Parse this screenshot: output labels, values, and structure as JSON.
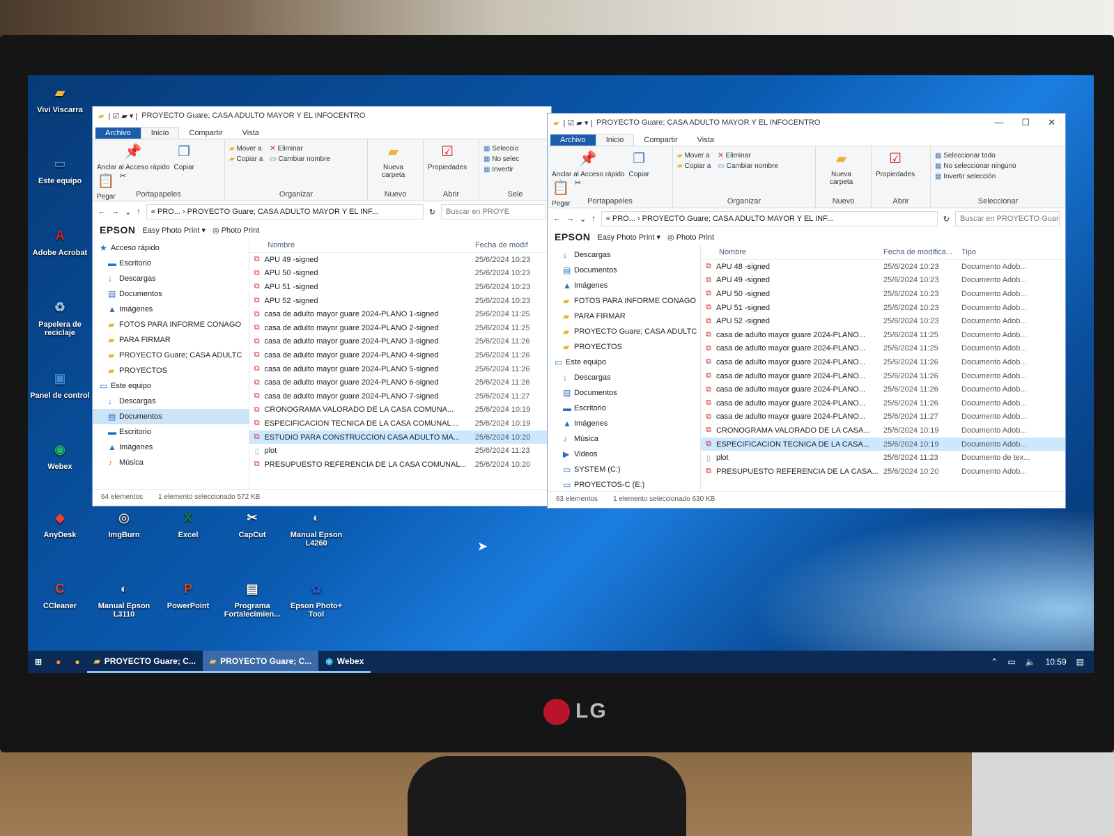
{
  "monitor": {
    "brand": "LG"
  },
  "desktop": {
    "icons": [
      {
        "label": "Vivi Viscarra",
        "icon": "folder-icon",
        "color": "#f2b632"
      },
      {
        "label": "Este equipo",
        "icon": "computer-icon",
        "color": "#3a8ad8"
      },
      {
        "label": "Adobe Acrobat",
        "icon": "acrobat-icon",
        "color": "#d3222a"
      },
      {
        "label": "Papelera de reciclaje",
        "icon": "recycle-bin-icon",
        "color": "#9cc8ee"
      },
      {
        "label": "Panel de control",
        "icon": "control-panel-icon",
        "color": "#3a8ad8"
      },
      {
        "label": "Webex",
        "icon": "webex-icon",
        "color": "#1eb46e"
      },
      {
        "label": "AnyDesk",
        "icon": "anydesk-icon",
        "color": "#e8412c"
      },
      {
        "label": "ImgBurn",
        "icon": "imgburn-icon",
        "color": "#cfcfcf"
      },
      {
        "label": "Excel",
        "icon": "excel-icon",
        "color": "#1e7a45"
      },
      {
        "label": "CapCut",
        "icon": "capcut-icon",
        "color": "#ffffff"
      },
      {
        "label": "Manual Epson L4260",
        "icon": "manual-icon",
        "color": "#cfd8e4"
      },
      {
        "label": "CCleaner",
        "icon": "ccleaner-icon",
        "color": "#e8412c"
      },
      {
        "label": "Manual Epson L3110",
        "icon": "manual-icon",
        "color": "#cfd8e4"
      },
      {
        "label": "PowerPoint",
        "icon": "powerpoint-icon",
        "color": "#d24726"
      },
      {
        "label": "Programa Fortalecimien...",
        "icon": "pdf-file-icon",
        "color": "#ffffff"
      },
      {
        "label": "Epson Photo+ Tool",
        "icon": "epson-photo-icon",
        "color": "#2a5fc8"
      }
    ]
  },
  "explorer_left": {
    "title": "PROYECTO Guare; CASA ADULTO MAYOR Y EL INFOCENTRO",
    "tabs": [
      "Archivo",
      "Inicio",
      "Compartir",
      "Vista"
    ],
    "ribbon": {
      "pin": "Anclar al Acceso rápido",
      "copy": "Copiar",
      "paste": "Pegar",
      "move": "Mover a",
      "copyto": "Copiar a",
      "delete": "Eliminar",
      "rename": "Cambiar nombre",
      "newfolder": "Nueva carpeta",
      "props": "Propiedades",
      "selall": "Seleccio",
      "selnone": "No selec",
      "invert": "Invertir",
      "g_clip": "Portapapeles",
      "g_org": "Organizar",
      "g_new": "Nuevo",
      "g_open": "Abrir",
      "g_sel": "Sele"
    },
    "address": {
      "path": "« PRO... › PROYECTO Guare; CASA ADULTO MAYOR Y EL INF...",
      "search": "Buscar en PROYE"
    },
    "epson": {
      "brand": "EPSON",
      "app": "Easy Photo Print",
      "photo": "Photo Print"
    },
    "nav": [
      {
        "label": "Acceso rápido",
        "icon": "star-icon",
        "sub": false,
        "sel": false
      },
      {
        "label": "Escritorio",
        "icon": "desktop-icon",
        "sub": true,
        "sel": false
      },
      {
        "label": "Descargas",
        "icon": "download-icon",
        "sub": true,
        "sel": false
      },
      {
        "label": "Documentos",
        "icon": "document-icon",
        "sub": true,
        "sel": false
      },
      {
        "label": "Imágenes",
        "icon": "image-icon",
        "sub": true,
        "sel": false
      },
      {
        "label": "FOTOS PARA INFORME CONAGO",
        "icon": "folder-icon",
        "sub": true,
        "sel": false
      },
      {
        "label": "PARA FIRMAR",
        "icon": "folder-icon",
        "sub": true,
        "sel": false
      },
      {
        "label": "PROYECTO Guare; CASA ADULTC",
        "icon": "folder-icon",
        "sub": true,
        "sel": false
      },
      {
        "label": "PROYECTOS",
        "icon": "folder-icon",
        "sub": true,
        "sel": false
      },
      {
        "label": "Este equipo",
        "icon": "computer-icon",
        "sub": false,
        "sel": false
      },
      {
        "label": "Descargas",
        "icon": "download-icon",
        "sub": true,
        "sel": false
      },
      {
        "label": "Documentos",
        "icon": "document-icon",
        "sub": true,
        "sel": true
      },
      {
        "label": "Escritorio",
        "icon": "desktop-icon",
        "sub": true,
        "sel": false
      },
      {
        "label": "Imágenes",
        "icon": "image-icon",
        "sub": true,
        "sel": false
      },
      {
        "label": "Música",
        "icon": "music-icon",
        "sub": true,
        "sel": false
      }
    ],
    "columns": {
      "name": "Nombre",
      "date": "Fecha de modif"
    },
    "files": [
      {
        "name": "APU 49 -signed",
        "date": "25/6/2024 10:23",
        "pdf": true,
        "sel": false
      },
      {
        "name": "APU 50 -signed",
        "date": "25/6/2024 10:23",
        "pdf": true,
        "sel": false
      },
      {
        "name": "APU 51 -signed",
        "date": "25/6/2024 10:23",
        "pdf": true,
        "sel": false
      },
      {
        "name": "APU 52 -signed",
        "date": "25/6/2024 10:23",
        "pdf": true,
        "sel": false
      },
      {
        "name": "casa de adulto mayor guare 2024-PLANO 1-signed",
        "date": "25/6/2024 11:25",
        "pdf": true,
        "sel": false
      },
      {
        "name": "casa de adulto mayor guare 2024-PLANO 2-signed",
        "date": "25/6/2024 11:25",
        "pdf": true,
        "sel": false
      },
      {
        "name": "casa de adulto mayor guare 2024-PLANO 3-signed",
        "date": "25/6/2024 11:26",
        "pdf": true,
        "sel": false
      },
      {
        "name": "casa de adulto mayor guare 2024-PLANO 4-signed",
        "date": "25/6/2024 11:26",
        "pdf": true,
        "sel": false
      },
      {
        "name": "casa de adulto mayor guare 2024-PLANO 5-signed",
        "date": "25/6/2024 11:26",
        "pdf": true,
        "sel": false
      },
      {
        "name": "casa de adulto mayor guare 2024-PLANO 6-signed",
        "date": "25/6/2024 11:26",
        "pdf": true,
        "sel": false
      },
      {
        "name": "casa de adulto mayor guare 2024-PLANO 7-signed",
        "date": "25/6/2024 11:27",
        "pdf": true,
        "sel": false
      },
      {
        "name": "CRONOGRAMA VALORADO DE LA CASA COMUNA...",
        "date": "25/6/2024 10:19",
        "pdf": true,
        "sel": false
      },
      {
        "name": "ESPECIFICACION TECNICA DE LA CASA COMUNAL ...",
        "date": "25/6/2024 10:19",
        "pdf": true,
        "sel": false
      },
      {
        "name": "ESTUDIO PARA CONSTRUCCION CASA ADULTO MA...",
        "date": "25/6/2024 10:20",
        "pdf": true,
        "sel": true
      },
      {
        "name": "plot",
        "date": "25/6/2024 11:23",
        "pdf": false,
        "sel": false
      },
      {
        "name": "PRESUPUESTO REFERENCIA DE LA CASA COMUNAL...",
        "date": "25/6/2024 10:20",
        "pdf": true,
        "sel": false
      }
    ],
    "status": {
      "count": "64 elementos",
      "selected": "1 elemento seleccionado 572 KB"
    }
  },
  "explorer_right": {
    "title": "PROYECTO Guare; CASA ADULTO MAYOR Y EL INFOCENTRO",
    "tabs": [
      "Archivo",
      "Inicio",
      "Compartir",
      "Vista"
    ],
    "ribbon": {
      "pin": "Anclar al Acceso rápido",
      "copy": "Copiar",
      "paste": "Pegar",
      "move": "Mover a",
      "copyto": "Copiar a",
      "delete": "Eliminar",
      "rename": "Cambiar nombre",
      "newfolder": "Nueva carpeta",
      "props": "Propiedades",
      "selall": "Seleccionar todo",
      "selnone": "No seleccionar ninguno",
      "invert": "Invertir selección",
      "g_clip": "Portapapeles",
      "g_org": "Organizar",
      "g_new": "Nuevo",
      "g_open": "Abrir",
      "g_sel": "Seleccionar"
    },
    "address": {
      "path": "« PRO... › PROYECTO Guare; CASA ADULTO MAYOR Y EL INF...",
      "search": "Buscar en PROYECTO Guare; ..."
    },
    "epson": {
      "brand": "EPSON",
      "app": "Easy Photo Print",
      "photo": "Photo Print"
    },
    "nav": [
      {
        "label": "Descargas",
        "icon": "download-icon",
        "sub": true,
        "sel": false
      },
      {
        "label": "Documentos",
        "icon": "document-icon",
        "sub": true,
        "sel": false
      },
      {
        "label": "Imágenes",
        "icon": "image-icon",
        "sub": true,
        "sel": false
      },
      {
        "label": "FOTOS PARA INFORME CONAGO",
        "icon": "folder-icon",
        "sub": true,
        "sel": false
      },
      {
        "label": "PARA FIRMAR",
        "icon": "folder-icon",
        "sub": true,
        "sel": false
      },
      {
        "label": "PROYECTO Guare; CASA ADULTC",
        "icon": "folder-icon",
        "sub": true,
        "sel": false
      },
      {
        "label": "PROYECTOS",
        "icon": "folder-icon",
        "sub": true,
        "sel": false
      },
      {
        "label": "Este equipo",
        "icon": "computer-icon",
        "sub": false,
        "sel": false
      },
      {
        "label": "Descargas",
        "icon": "download-icon",
        "sub": true,
        "sel": false
      },
      {
        "label": "Documentos",
        "icon": "document-icon",
        "sub": true,
        "sel": false
      },
      {
        "label": "Escritorio",
        "icon": "desktop-icon",
        "sub": true,
        "sel": false
      },
      {
        "label": "Imágenes",
        "icon": "image-icon",
        "sub": true,
        "sel": false
      },
      {
        "label": "Música",
        "icon": "music-icon",
        "sub": true,
        "sel": false
      },
      {
        "label": "Videos",
        "icon": "video-icon",
        "sub": true,
        "sel": false
      },
      {
        "label": "SYSTEM (C:)",
        "icon": "drive-icon",
        "sub": true,
        "sel": false
      },
      {
        "label": "PROYECTOS-C (E:)",
        "icon": "drive-icon",
        "sub": true,
        "sel": false
      }
    ],
    "columns": {
      "name": "Nombre",
      "date": "Fecha de modifica...",
      "type": "Tipo"
    },
    "files": [
      {
        "name": "APU 48 -signed",
        "date": "25/6/2024 10:23",
        "type": "Documento Adob...",
        "pdf": true,
        "sel": false
      },
      {
        "name": "APU 49 -signed",
        "date": "25/6/2024 10:23",
        "type": "Documento Adob...",
        "pdf": true,
        "sel": false
      },
      {
        "name": "APU 50 -signed",
        "date": "25/6/2024 10:23",
        "type": "Documento Adob...",
        "pdf": true,
        "sel": false
      },
      {
        "name": "APU 51 -signed",
        "date": "25/6/2024 10:23",
        "type": "Documento Adob...",
        "pdf": true,
        "sel": false
      },
      {
        "name": "APU 52 -signed",
        "date": "25/6/2024 10:23",
        "type": "Documento Adob...",
        "pdf": true,
        "sel": false
      },
      {
        "name": "casa de adulto mayor guare 2024-PLANO...",
        "date": "25/6/2024 11:25",
        "type": "Documento Adob...",
        "pdf": true,
        "sel": false
      },
      {
        "name": "casa de adulto mayor guare 2024-PLANO...",
        "date": "25/6/2024 11:25",
        "type": "Documento Adob...",
        "pdf": true,
        "sel": false
      },
      {
        "name": "casa de adulto mayor guare 2024-PLANO...",
        "date": "25/6/2024 11:26",
        "type": "Documento Adob...",
        "pdf": true,
        "sel": false
      },
      {
        "name": "casa de adulto mayor guare 2024-PLANO...",
        "date": "25/6/2024 11:26",
        "type": "Documento Adob...",
        "pdf": true,
        "sel": false
      },
      {
        "name": "casa de adulto mayor guare 2024-PLANO...",
        "date": "25/6/2024 11:26",
        "type": "Documento Adob...",
        "pdf": true,
        "sel": false
      },
      {
        "name": "casa de adulto mayor guare 2024-PLANO...",
        "date": "25/6/2024 11:26",
        "type": "Documento Adob...",
        "pdf": true,
        "sel": false
      },
      {
        "name": "casa de adulto mayor guare 2024-PLANO...",
        "date": "25/6/2024 11:27",
        "type": "Documento Adob...",
        "pdf": true,
        "sel": false
      },
      {
        "name": "CRONOGRAMA VALORADO DE LA CASA...",
        "date": "25/6/2024 10:19",
        "type": "Documento Adob...",
        "pdf": true,
        "sel": false
      },
      {
        "name": "ESPECIFICACION TECNICA DE LA CASA...",
        "date": "25/6/2024 10:19",
        "type": "Documento Adob...",
        "pdf": true,
        "sel": true
      },
      {
        "name": "plot",
        "date": "25/6/2024 11:23",
        "type": "Documento de tex...",
        "pdf": false,
        "sel": false
      },
      {
        "name": "PRESUPUESTO REFERENCIA DE LA CASA...",
        "date": "25/6/2024 10:20",
        "type": "Documento Adob...",
        "pdf": true,
        "sel": false
      }
    ],
    "status": {
      "count": "63 elementos",
      "selected": "1 elemento seleccionado 630 KB"
    }
  },
  "taskbar": {
    "items": [
      {
        "label": "PROYECTO Guare; C...",
        "icon": "folder-icon",
        "state": "open"
      },
      {
        "label": "PROYECTO Guare; C...",
        "icon": "folder-icon",
        "state": "active"
      },
      {
        "label": "Webex",
        "icon": "webex-icon",
        "state": "open"
      }
    ],
    "time": "10:59"
  }
}
